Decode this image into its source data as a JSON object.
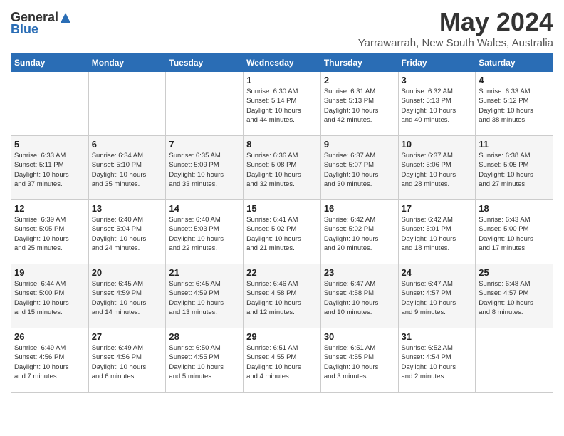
{
  "logo": {
    "general": "General",
    "blue": "Blue"
  },
  "title": "May 2024",
  "location": "Yarrawarrah, New South Wales, Australia",
  "weekdays": [
    "Sunday",
    "Monday",
    "Tuesday",
    "Wednesday",
    "Thursday",
    "Friday",
    "Saturday"
  ],
  "weeks": [
    [
      {
        "day": "",
        "info": ""
      },
      {
        "day": "",
        "info": ""
      },
      {
        "day": "",
        "info": ""
      },
      {
        "day": "1",
        "info": "Sunrise: 6:30 AM\nSunset: 5:14 PM\nDaylight: 10 hours\nand 44 minutes."
      },
      {
        "day": "2",
        "info": "Sunrise: 6:31 AM\nSunset: 5:13 PM\nDaylight: 10 hours\nand 42 minutes."
      },
      {
        "day": "3",
        "info": "Sunrise: 6:32 AM\nSunset: 5:13 PM\nDaylight: 10 hours\nand 40 minutes."
      },
      {
        "day": "4",
        "info": "Sunrise: 6:33 AM\nSunset: 5:12 PM\nDaylight: 10 hours\nand 38 minutes."
      }
    ],
    [
      {
        "day": "5",
        "info": "Sunrise: 6:33 AM\nSunset: 5:11 PM\nDaylight: 10 hours\nand 37 minutes."
      },
      {
        "day": "6",
        "info": "Sunrise: 6:34 AM\nSunset: 5:10 PM\nDaylight: 10 hours\nand 35 minutes."
      },
      {
        "day": "7",
        "info": "Sunrise: 6:35 AM\nSunset: 5:09 PM\nDaylight: 10 hours\nand 33 minutes."
      },
      {
        "day": "8",
        "info": "Sunrise: 6:36 AM\nSunset: 5:08 PM\nDaylight: 10 hours\nand 32 minutes."
      },
      {
        "day": "9",
        "info": "Sunrise: 6:37 AM\nSunset: 5:07 PM\nDaylight: 10 hours\nand 30 minutes."
      },
      {
        "day": "10",
        "info": "Sunrise: 6:37 AM\nSunset: 5:06 PM\nDaylight: 10 hours\nand 28 minutes."
      },
      {
        "day": "11",
        "info": "Sunrise: 6:38 AM\nSunset: 5:05 PM\nDaylight: 10 hours\nand 27 minutes."
      }
    ],
    [
      {
        "day": "12",
        "info": "Sunrise: 6:39 AM\nSunset: 5:05 PM\nDaylight: 10 hours\nand 25 minutes."
      },
      {
        "day": "13",
        "info": "Sunrise: 6:40 AM\nSunset: 5:04 PM\nDaylight: 10 hours\nand 24 minutes."
      },
      {
        "day": "14",
        "info": "Sunrise: 6:40 AM\nSunset: 5:03 PM\nDaylight: 10 hours\nand 22 minutes."
      },
      {
        "day": "15",
        "info": "Sunrise: 6:41 AM\nSunset: 5:02 PM\nDaylight: 10 hours\nand 21 minutes."
      },
      {
        "day": "16",
        "info": "Sunrise: 6:42 AM\nSunset: 5:02 PM\nDaylight: 10 hours\nand 20 minutes."
      },
      {
        "day": "17",
        "info": "Sunrise: 6:42 AM\nSunset: 5:01 PM\nDaylight: 10 hours\nand 18 minutes."
      },
      {
        "day": "18",
        "info": "Sunrise: 6:43 AM\nSunset: 5:00 PM\nDaylight: 10 hours\nand 17 minutes."
      }
    ],
    [
      {
        "day": "19",
        "info": "Sunrise: 6:44 AM\nSunset: 5:00 PM\nDaylight: 10 hours\nand 15 minutes."
      },
      {
        "day": "20",
        "info": "Sunrise: 6:45 AM\nSunset: 4:59 PM\nDaylight: 10 hours\nand 14 minutes."
      },
      {
        "day": "21",
        "info": "Sunrise: 6:45 AM\nSunset: 4:59 PM\nDaylight: 10 hours\nand 13 minutes."
      },
      {
        "day": "22",
        "info": "Sunrise: 6:46 AM\nSunset: 4:58 PM\nDaylight: 10 hours\nand 12 minutes."
      },
      {
        "day": "23",
        "info": "Sunrise: 6:47 AM\nSunset: 4:58 PM\nDaylight: 10 hours\nand 10 minutes."
      },
      {
        "day": "24",
        "info": "Sunrise: 6:47 AM\nSunset: 4:57 PM\nDaylight: 10 hours\nand 9 minutes."
      },
      {
        "day": "25",
        "info": "Sunrise: 6:48 AM\nSunset: 4:57 PM\nDaylight: 10 hours\nand 8 minutes."
      }
    ],
    [
      {
        "day": "26",
        "info": "Sunrise: 6:49 AM\nSunset: 4:56 PM\nDaylight: 10 hours\nand 7 minutes."
      },
      {
        "day": "27",
        "info": "Sunrise: 6:49 AM\nSunset: 4:56 PM\nDaylight: 10 hours\nand 6 minutes."
      },
      {
        "day": "28",
        "info": "Sunrise: 6:50 AM\nSunset: 4:55 PM\nDaylight: 10 hours\nand 5 minutes."
      },
      {
        "day": "29",
        "info": "Sunrise: 6:51 AM\nSunset: 4:55 PM\nDaylight: 10 hours\nand 4 minutes."
      },
      {
        "day": "30",
        "info": "Sunrise: 6:51 AM\nSunset: 4:55 PM\nDaylight: 10 hours\nand 3 minutes."
      },
      {
        "day": "31",
        "info": "Sunrise: 6:52 AM\nSunset: 4:54 PM\nDaylight: 10 hours\nand 2 minutes."
      },
      {
        "day": "",
        "info": ""
      }
    ]
  ]
}
